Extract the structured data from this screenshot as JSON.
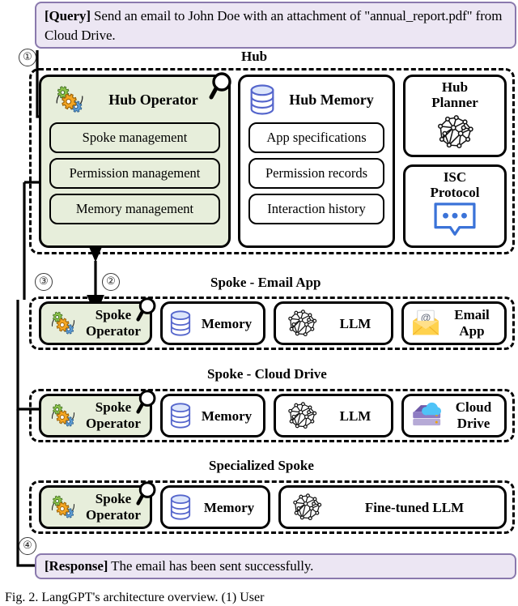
{
  "figure": {
    "caption": "Fig. 2.  LangGPT's architecture overview. (1) User"
  },
  "query": {
    "tag": "[Query]",
    "text": " Send an email to John Doe with an attachment of \"annual_report.pdf\" from Cloud Drive."
  },
  "response": {
    "tag": "[Response]",
    "text": " The email has been sent successfully."
  },
  "steps": {
    "one": "①",
    "two": "②",
    "three": "③",
    "four": "④"
  },
  "hub": {
    "title": "Hub",
    "operator": {
      "title": "Hub Operator",
      "icon": "gears-icon",
      "magnifier": "magnifier-icon",
      "items": [
        "Spoke management",
        "Permission management",
        "Memory management"
      ]
    },
    "memory": {
      "title": "Hub Memory",
      "icon": "database-icon",
      "items": [
        "App specifications",
        "Permission records",
        "Interaction history"
      ]
    },
    "planner": {
      "line1": "Hub",
      "line2": "Planner",
      "icon": "neural-network-icon"
    },
    "protocol": {
      "line1": "ISC",
      "line2": "Protocol",
      "icon": "speech-bubble-icon"
    }
  },
  "spokes": [
    {
      "title": "Spoke - Email App",
      "cards": [
        {
          "label": "Spoke\nOperator",
          "icon": "gears-icon",
          "green": true,
          "magnifier": true
        },
        {
          "label": "Memory",
          "icon": "database-icon"
        },
        {
          "label": "LLM",
          "icon": "neural-network-icon"
        },
        {
          "label": "Email\nApp",
          "icon": "email-envelope-icon"
        }
      ]
    },
    {
      "title": "Spoke - Cloud Drive",
      "cards": [
        {
          "label": "Spoke\nOperator",
          "icon": "gears-icon",
          "green": true,
          "magnifier": true
        },
        {
          "label": "Memory",
          "icon": "database-icon"
        },
        {
          "label": "LLM",
          "icon": "neural-network-icon"
        },
        {
          "label": "Cloud\nDrive",
          "icon": "cloud-drive-icon"
        }
      ]
    },
    {
      "title": "Specialized Spoke",
      "cards": [
        {
          "label": "Spoke\nOperator",
          "icon": "gears-icon",
          "green": true,
          "magnifier": true
        },
        {
          "label": "Memory",
          "icon": "database-icon"
        },
        {
          "label": "Fine-tuned LLM",
          "icon": "neural-network-icon"
        }
      ]
    }
  ],
  "spoke_email": {
    "title": "Spoke - Email App",
    "operator_line1": "Spoke",
    "operator_line2": "Operator",
    "memory": "Memory",
    "llm": "LLM",
    "app_line1": "Email",
    "app_line2": "App"
  },
  "spoke_cloud": {
    "title": "Spoke - Cloud Drive",
    "operator_line1": "Spoke",
    "operator_line2": "Operator",
    "memory": "Memory",
    "llm": "LLM",
    "app_line1": "Cloud",
    "app_line2": "Drive"
  },
  "spoke_specialized": {
    "title": "Specialized Spoke",
    "operator_line1": "Spoke",
    "operator_line2": "Operator",
    "memory": "Memory",
    "llm": "Fine-tuned LLM"
  },
  "colors": {
    "bubble_bg": "#ece6f3",
    "bubble_border": "#8a79ad",
    "operator_bg": "#e7eedb",
    "database_blue": "#4a63c8",
    "protocol_blue": "#3b73d8",
    "gear_green": "#7cb342",
    "gear_orange": "#f5a623",
    "gear_blue": "#4a90d9",
    "envelope_yellow": "#ffd24d",
    "cloud_blue": "#4fc3f7",
    "drive_purple": "#6f5aa8",
    "stroke": "#000000"
  }
}
